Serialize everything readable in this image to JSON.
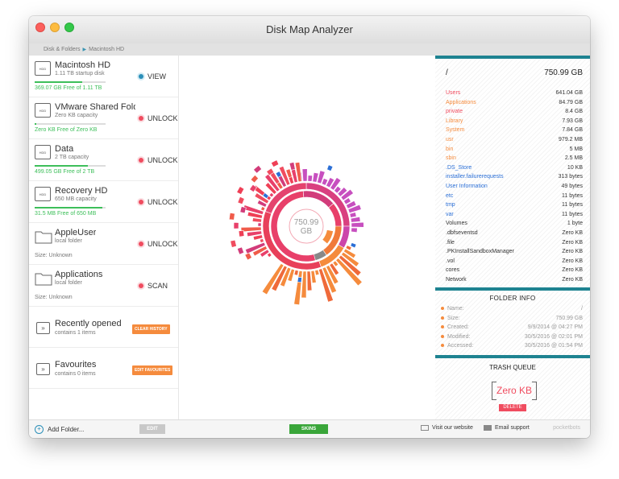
{
  "window": {
    "title": "Disk Map Analyzer"
  },
  "breadcrumb": {
    "items": [
      "Disk & Folders",
      "Macintosh HD"
    ]
  },
  "drives": [
    {
      "name": "Macintosh HD",
      "sub": "1.11 TB startup disk",
      "free": "369.07 GB Free of 1.11 TB",
      "used_fraction": 0.67,
      "action": "VIEW",
      "action_color": "blue",
      "icon": "hdd-icon"
    },
    {
      "name": "VMware Shared Fold...",
      "sub": "Zero KB capacity",
      "free": "Zero KB Free of Zero KB",
      "used_fraction": 0.02,
      "action": "UNLOCK",
      "action_color": "red",
      "icon": "hdd-icon"
    },
    {
      "name": "Data",
      "sub": "2 TB capacity",
      "free": "499.05 GB Free of 2 TB",
      "used_fraction": 0.75,
      "action": "UNLOCK",
      "action_color": "red",
      "icon": "hdd-icon"
    },
    {
      "name": "Recovery HD",
      "sub": "650 MB capacity",
      "free": "31.5 MB Free of 650 MB",
      "used_fraction": 0.95,
      "action": "UNLOCK",
      "action_color": "red",
      "icon": "hdd-icon"
    },
    {
      "name": "AppleUser",
      "sub": "local folder",
      "free": "Size: Unknown",
      "action": "UNLOCK",
      "action_color": "red",
      "icon": "folder-icon"
    },
    {
      "name": "Applications",
      "sub": "local folder",
      "free": "Size: Unknown",
      "action": "SCAN",
      "action_color": "red",
      "icon": "folder-icon"
    }
  ],
  "specials": [
    {
      "name": "Recently opened",
      "sub": "contains 1 items",
      "button": "CLEAR HISTORY"
    },
    {
      "name": "Favourites",
      "sub": "contains 0 items",
      "button": "EDIT FAVOURITES"
    }
  ],
  "center": {
    "size_line1": "750.99",
    "size_line2": "GB"
  },
  "right": {
    "root": "/",
    "root_size": "750.99 GB",
    "items": [
      {
        "name": "Users",
        "size": "641.04 GB",
        "color": "#f04c5f"
      },
      {
        "name": "Applications",
        "size": "84.79 GB",
        "color": "#f58b3d"
      },
      {
        "name": "private",
        "size": "8.4 GB",
        "color": "#f04c5f"
      },
      {
        "name": "Library",
        "size": "7.93 GB",
        "color": "#f58b3d"
      },
      {
        "name": "System",
        "size": "7.84 GB",
        "color": "#f58b3d"
      },
      {
        "name": "usr",
        "size": "979.2 MB",
        "color": "#f58b3d"
      },
      {
        "name": "bin",
        "size": "5 MB",
        "color": "#f58b3d"
      },
      {
        "name": "sbin",
        "size": "2.5 MB",
        "color": "#f58b3d"
      },
      {
        "name": ".DS_Store",
        "size": "10 KB",
        "color": "#2b6fd6"
      },
      {
        "name": "installer.failurerequests",
        "size": "313 bytes",
        "color": "#2b6fd6"
      },
      {
        "name": "User Information",
        "size": "49 bytes",
        "color": "#2b6fd6"
      },
      {
        "name": "etc",
        "size": "11 bytes",
        "color": "#2b6fd6"
      },
      {
        "name": "tmp",
        "size": "11 bytes",
        "color": "#2b6fd6"
      },
      {
        "name": "var",
        "size": "11 bytes",
        "color": "#2b6fd6"
      },
      {
        "name": "Volumes",
        "size": "1 byte",
        "color": "#333333"
      },
      {
        "name": ".dbfseventsd",
        "size": "Zero KB",
        "color": "#333333"
      },
      {
        "name": ".file",
        "size": "Zero KB",
        "color": "#333333"
      },
      {
        "name": ".PKInstallSandboxManager",
        "size": "Zero KB",
        "color": "#333333"
      },
      {
        "name": ".vol",
        "size": "Zero KB",
        "color": "#333333"
      },
      {
        "name": "cores",
        "size": "Zero KB",
        "color": "#333333"
      },
      {
        "name": "Network",
        "size": "Zero KB",
        "color": "#333333"
      }
    ],
    "folder_info": {
      "title": "FOLDER INFO",
      "rows": [
        {
          "label": "Name:",
          "value": "/"
        },
        {
          "label": "Size:",
          "value": "750.99 GB"
        },
        {
          "label": "Created:",
          "value": "9/9/2014 @ 04:27 PM"
        },
        {
          "label": "Modified:",
          "value": "30/5/2016 @ 02:01 PM"
        },
        {
          "label": "Accessed:",
          "value": "30/5/2016 @ 01:54 PM"
        }
      ]
    },
    "trash": {
      "title": "TRASH QUEUE",
      "size": "Zero KB",
      "delete_label": "DELETE"
    }
  },
  "footer": {
    "add_folder": "Add Folder...",
    "edit": "EDIT",
    "skins": "SKINS",
    "visit": "Visit our website",
    "email": "Email support",
    "brand": "pocketbots"
  }
}
